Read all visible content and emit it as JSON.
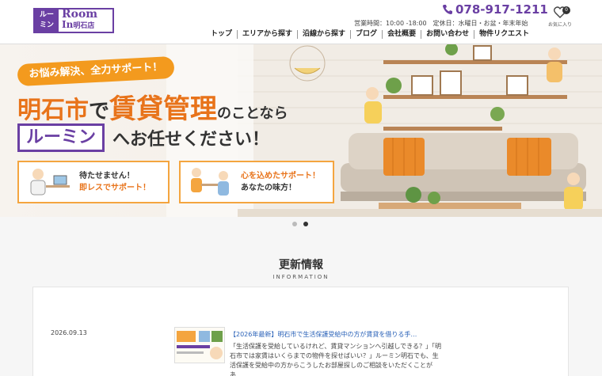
{
  "header": {
    "logo_left_top": "ルー",
    "logo_left_bottom": "ミン",
    "logo_room": "Room",
    "logo_in": "In",
    "logo_branch": "明石店",
    "phone": "078-917-1211",
    "hours": "営業時間：10:00 -18:00　定休日：水曜日・お盆・年末年始",
    "favorites_label": "お気に入り",
    "favorites_count": "0"
  },
  "nav": {
    "items": [
      "トップ",
      "エリアから探す",
      "沿線から探す",
      "ブログ",
      "会社概要",
      "お問い合わせ",
      "物件リクエスト"
    ]
  },
  "hero": {
    "tag": "お悩み解決、全力サポート！",
    "headline_city": "明石市",
    "headline_de": "で",
    "headline_main": "賃貸管理",
    "headline_tail": "のことなら",
    "brand": "ルーミン",
    "headline_cta": "へお任せください！",
    "card1_line1": "待たせません！",
    "card1_line2": "即レスでサポート！",
    "card2_line1": "心を込めたサポート！",
    "card2_line2": "あなたの味方！"
  },
  "slider": {
    "dots": 2,
    "active": 2
  },
  "info": {
    "title": "更新情報",
    "subtitle": "INFORMATION",
    "news": [
      {
        "date": "2026.09.13",
        "title": "【2026年最新】明石市で生活保護受給中の方が賃貸を借りる手…",
        "body": "「生活保護を受給しているけれど、賃貸マンションへ引越しできる？」「明石市では家賃はいくらまでの物件を探せばいい？」ルーミン明石でも、生活保護を受給中の方からこうしたお部屋探しのご相談をいただくことがあ…"
      }
    ]
  },
  "colors": {
    "brand_purple": "#6a3fa3",
    "accent_orange": "#e8731a",
    "link_blue": "#2a62b8"
  }
}
